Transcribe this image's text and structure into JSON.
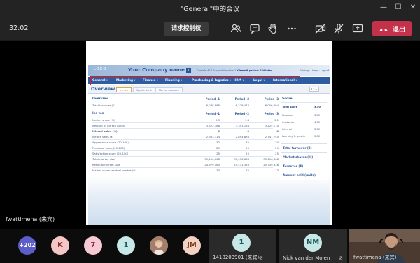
{
  "window": {
    "title": "\"General\"中的会议",
    "minimize_label": "—",
    "maximize_label": "☐",
    "close_label": "✕"
  },
  "toolbar": {
    "clock": "32:02",
    "control_label": "请求控制权",
    "leave_label": "退出",
    "leave_color": "#c4314b",
    "icons": [
      "participants-icon",
      "chat-icon",
      "raise-hand-icon",
      "more-icon",
      "camera-off-icon",
      "mic-off-icon",
      "share-icon",
      "phone-hangup-icon"
    ]
  },
  "slide": {
    "logo": "LOGO",
    "company": "Your Company name",
    "flag_label": "i",
    "header_meta_1": "Gamble 4S4",
    "header_meta_2": "Support function 1 - Team 1",
    "current_period": "Current period: 1 Winter",
    "links": "Settings · Help · Log off",
    "nav": [
      "General ▾",
      "Marketing ▾",
      "Finance ▾",
      "Planning ▾",
      "Purchasing & logistics ▾",
      "HRM ▾",
      "Legal ▾",
      "International ▾"
    ],
    "tabs": {
      "title": "Overview",
      "items": [
        "Ice tea",
        "Sports drink",
        "Market research"
      ],
      "active": "Ice tea",
      "period_select": "P 3 ▾"
    },
    "overview": {
      "heading": "Overview",
      "period_headers": [
        "Period -1",
        "Period -2",
        "Period -3"
      ],
      "rows": [
        {
          "label": "Total turnover (€)",
          "values": [
            "6,078,888",
            "6,226,474",
            "6,006,494"
          ]
        }
      ]
    },
    "ice_tea": {
      "heading": "Ice tea",
      "period_headers": [
        "Period -1",
        "Period -2",
        "Period -3"
      ],
      "rows": [
        {
          "label": "Market share (%)",
          "values": [
            "9.3",
            "9.4",
            "9.1"
          ],
          "bold": false
        },
        {
          "label": "Amount of ice tea (units)",
          "values": [
            "3,322,388",
            "3,391,134",
            "3,225,170"
          ],
          "bold": false
        },
        {
          "label": "Missed sales (%)",
          "values": [
            "0",
            "0",
            "0"
          ],
          "bold": true
        },
        {
          "label": "Ice tea sales (€)",
          "values": [
            "2,983,314",
            "2,894,836",
            "2,741,755"
          ],
          "bold": false
        },
        {
          "label": "Appearance score (20-100)",
          "values": [
            "32",
            "32",
            "30"
          ],
          "bold": false
        },
        {
          "label": "Purchase score (20-100)",
          "values": [
            "29",
            "29",
            "29"
          ],
          "bold": false
        },
        {
          "label": "Satisfaction score (20-100)",
          "values": [
            "25",
            "25",
            "25"
          ],
          "bold": false
        },
        {
          "label": "Total market size",
          "values": [
            "35,416,668",
            "35,416,668",
            "35,416,668"
          ],
          "bold": false
        },
        {
          "label": "Residual market size",
          "values": [
            "24,879,560",
            "25,411,356",
            "25,739,936"
          ],
          "bold": false
        },
        {
          "label": "Market share residual market (%)",
          "values": [
            "70",
            "72",
            "73"
          ],
          "bold": false
        }
      ]
    },
    "score": {
      "title": "Score",
      "rows": [
        {
          "label": "Total score",
          "value": "3.50",
          "strong": true
        },
        {
          "label": "Financial",
          "value": "3.50",
          "strong": false
        },
        {
          "label": "Customer",
          "value": "4.00",
          "strong": false
        },
        {
          "label": "Internal",
          "value": "3.50",
          "strong": false
        },
        {
          "label": "Learning & growth",
          "value": "3.00",
          "strong": false
        }
      ],
      "boxes": [
        "Total turnover (€)",
        "Market shares (%)",
        "Turnover (€)",
        "Amount sold (units)"
      ]
    },
    "highlight_color": "#e21a1a"
  },
  "presenter": {
    "name": "fwattimena (来宾)"
  },
  "participants": {
    "overflow": "+202",
    "avatars": [
      {
        "initials": "K",
        "bg": "#f4c6c6",
        "fg": "#8a2a2a"
      },
      {
        "initials": "7",
        "bg": "#f7c9d4",
        "fg": "#8a2b45"
      },
      {
        "initials": "1",
        "bg": "#c8e7e7",
        "fg": "#1d5b5b"
      },
      {
        "initials": "JM",
        "bg": "#f2d2c2",
        "fg": "#7a3a1e"
      }
    ],
    "tiles": [
      {
        "name": "1418203901 (来宾)",
        "initials": "1"
      },
      {
        "name": "Nick van der Molen",
        "initials": "NM"
      },
      {
        "name": "fwattimena (来宾)",
        "initials": ""
      }
    ]
  }
}
